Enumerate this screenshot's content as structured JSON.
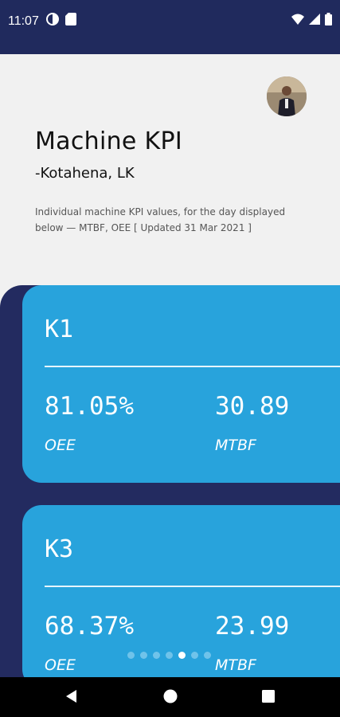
{
  "status_bar": {
    "time": "11:07",
    "left_icons": [
      "data-saver-icon",
      "sd-card-icon"
    ],
    "right_icons": [
      "wifi-icon",
      "signal-icon",
      "battery-icon"
    ]
  },
  "header": {
    "avatar": "user-avatar",
    "title": "Machine KPI",
    "subtitle": "-Kotahena, LK",
    "description": "Individual machine KPI values, for the day displayed below — MTBF, OEE [ Updated 31 Mar 2021 ]"
  },
  "cards": [
    {
      "machine": "K1",
      "metrics": [
        {
          "value": "81.05%",
          "label": "OEE"
        },
        {
          "value": "30.89",
          "label": "MTBF"
        }
      ]
    },
    {
      "machine": "K3",
      "metrics": [
        {
          "value": "68.37%",
          "label": "OEE"
        },
        {
          "value": "23.99",
          "label": "MTBF"
        }
      ]
    }
  ],
  "pager": {
    "count": 7,
    "active_index": 4
  },
  "nav_bar": {
    "buttons": [
      "back-icon",
      "home-icon",
      "recents-icon"
    ]
  },
  "colors": {
    "navy": "#232b60",
    "card_blue": "#28a3dc",
    "background": "#f1f1f1"
  }
}
